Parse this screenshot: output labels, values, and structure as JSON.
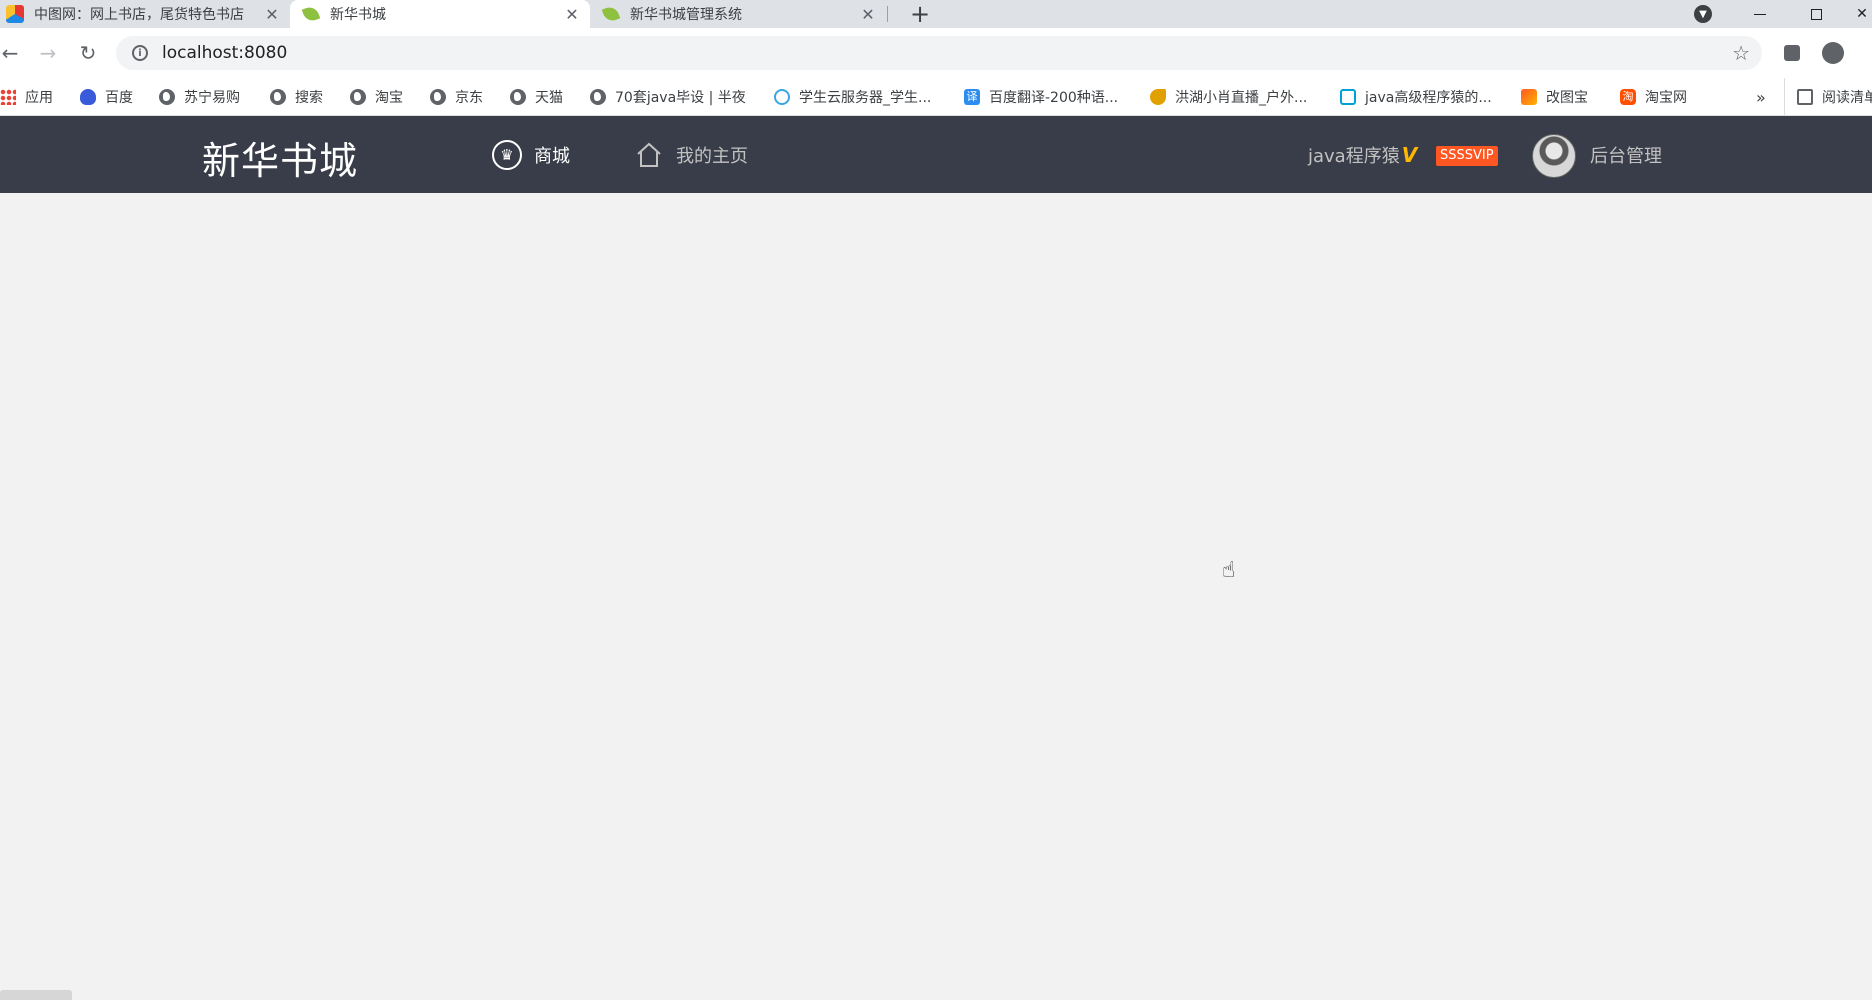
{
  "browser": {
    "tabs": [
      {
        "title": "中图网：网上书店，尾货特色书店",
        "icon": "zhongtu-favicon"
      },
      {
        "title": "新华书城",
        "icon": "spring-leaf-favicon"
      },
      {
        "title": "新华书城管理系统",
        "icon": "spring-leaf-favicon"
      }
    ],
    "new_tab_label": "+",
    "close_glyph": "✕",
    "url": "localhost:8080",
    "bookmarks": [
      {
        "label": "应用",
        "icon": "apps-grid-icon"
      },
      {
        "label": "百度",
        "icon": "baidu-paw-icon"
      },
      {
        "label": "苏宁易购",
        "icon": "globe-icon"
      },
      {
        "label": "搜索",
        "icon": "globe-icon"
      },
      {
        "label": "淘宝",
        "icon": "globe-icon"
      },
      {
        "label": "京东",
        "icon": "globe-icon"
      },
      {
        "label": "天猫",
        "icon": "globe-icon"
      },
      {
        "label": "70套java毕设 | 半夜",
        "icon": "globe-icon"
      },
      {
        "label": "学生云服务器_学生...",
        "icon": "cloud-icon"
      },
      {
        "label": "百度翻译-200种语...",
        "icon": "baidu-translate-icon"
      },
      {
        "label": "洪湖小肖直播_户外...",
        "icon": "bird-icon"
      },
      {
        "label": "java高级程序猿的...",
        "icon": "bilibili-tv-icon"
      },
      {
        "label": "改图宝",
        "icon": "gaitubao-icon"
      },
      {
        "label": "淘宝网",
        "icon": "taobao-icon"
      }
    ],
    "bookmarks_overflow": "»",
    "reading_list": "阅读清单"
  },
  "site": {
    "logo": "新华书城",
    "nav": [
      {
        "label": "商城",
        "icon": "crown-icon"
      },
      {
        "label": "我的主页",
        "icon": "home-icon"
      }
    ],
    "user": {
      "name": "java程序猿",
      "v_mark": "V",
      "vip_badge": "SSSSVIP",
      "admin_link": "后台管理"
    },
    "header_bg": "#393d49",
    "vip_color": "#ff5722",
    "v_color": "#ffb800"
  }
}
